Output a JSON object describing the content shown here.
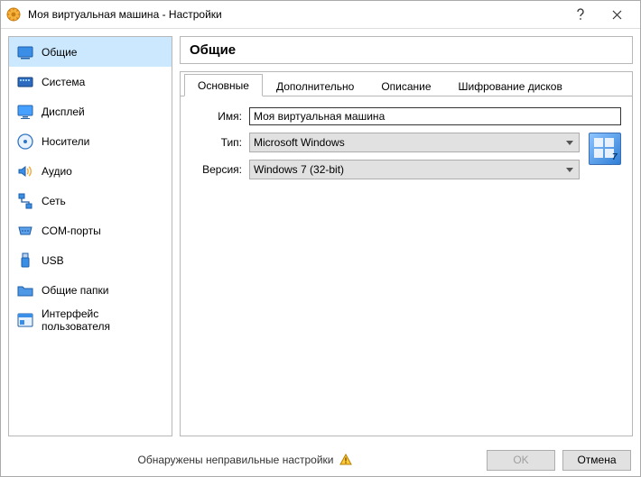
{
  "titlebar": {
    "title": "Моя виртуальная машина - Настройки"
  },
  "sidebar": {
    "items": [
      {
        "label": "Общие",
        "icon": "general"
      },
      {
        "label": "Система",
        "icon": "system"
      },
      {
        "label": "Дисплей",
        "icon": "display"
      },
      {
        "label": "Носители",
        "icon": "storage"
      },
      {
        "label": "Аудио",
        "icon": "audio"
      },
      {
        "label": "Сеть",
        "icon": "network"
      },
      {
        "label": "COM-порты",
        "icon": "serial"
      },
      {
        "label": "USB",
        "icon": "usb"
      },
      {
        "label": "Общие папки",
        "icon": "shared"
      },
      {
        "label": "Интерфейс пользователя",
        "icon": "interface"
      }
    ],
    "selected_index": 0
  },
  "heading": "Общие",
  "tabs": {
    "items": [
      "Основные",
      "Дополнительно",
      "Описание",
      "Шифрование дисков"
    ],
    "active_index": 0
  },
  "form": {
    "name_label": "Имя:",
    "name_value": "Моя виртуальная машина",
    "type_label": "Тип:",
    "type_value": "Microsoft Windows",
    "version_label": "Версия:",
    "version_value": "Windows 7 (32-bit)"
  },
  "footer": {
    "status": "Обнаружены неправильные настройки",
    "ok": "OK",
    "cancel": "Отмена"
  }
}
